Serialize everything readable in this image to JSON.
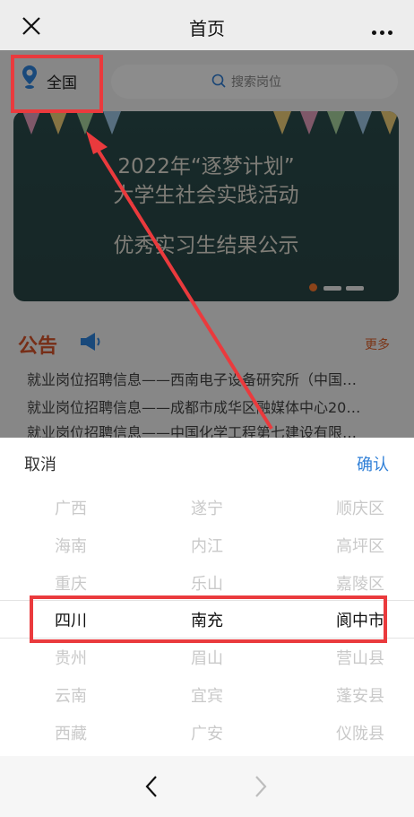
{
  "topbar": {
    "title": "首页"
  },
  "page": {
    "location": "全国",
    "search_placeholder": "搜索岗位",
    "banner": {
      "line1": "2022年“逐梦计划”",
      "line2": "大学生社会实践活动",
      "line3": "优秀实习生结果公示"
    },
    "notice_title": "公告",
    "more_label": "更多",
    "notices": [
      "就业岗位招聘信息——西南电子设备研究所（中国…",
      "就业岗位招聘信息——成都市成华区融媒体中心20…",
      "就业岗位招聘信息——中国化学工程第七建设有限…"
    ]
  },
  "picker": {
    "cancel_label": "取消",
    "confirm_label": "确认",
    "provinces": [
      "广西",
      "海南",
      "重庆",
      "四川",
      "贵州",
      "云南",
      "西藏"
    ],
    "cities": [
      "遂宁",
      "内江",
      "乐山",
      "南充",
      "眉山",
      "宜宾",
      "广安"
    ],
    "districts": [
      "顺庆区",
      "高坪区",
      "嘉陵区",
      "阆中市",
      "营山县",
      "蓬安县",
      "仪陇县"
    ],
    "selected_index": 3
  },
  "colors": {
    "highlight": "#ea3a3d",
    "confirm": "#2f7fd7",
    "accent": "#e0632d"
  }
}
